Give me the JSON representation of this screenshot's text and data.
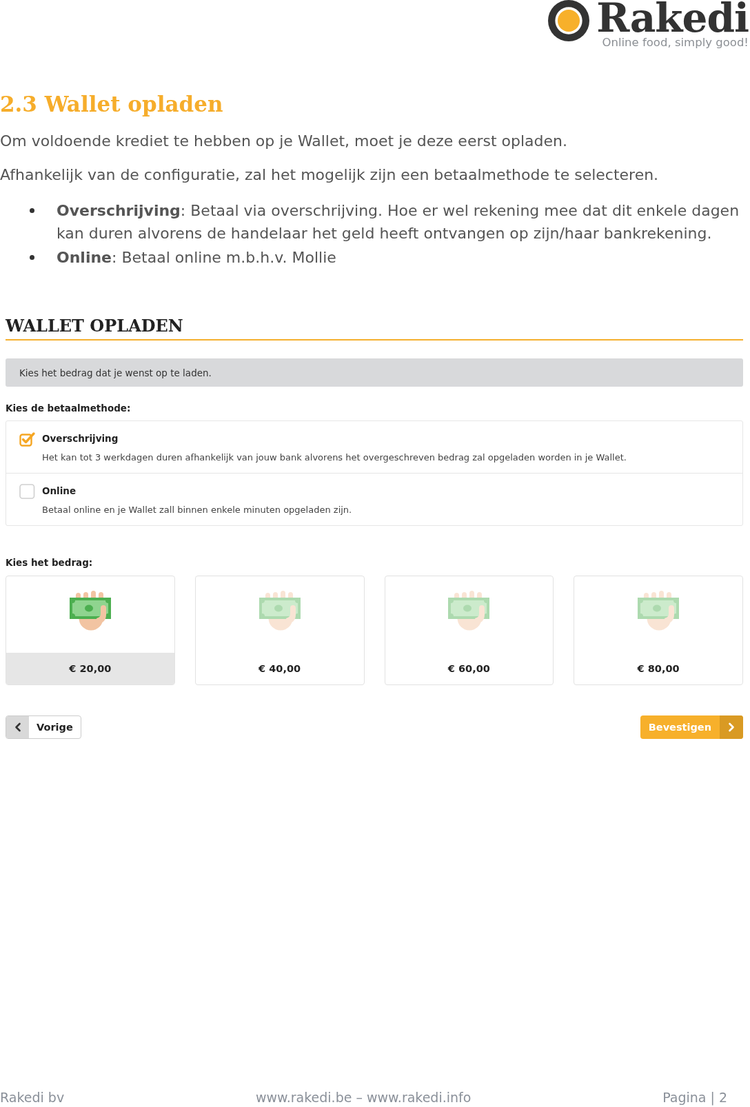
{
  "logo": {
    "name": "Rakedi",
    "tagline": "Online food, simply good!"
  },
  "heading": "2.3 Wallet opladen",
  "paragraphs": [
    "Om voldoende krediet te hebben op je Wallet, moet je deze eerst opladen.",
    "Afhankelijk van de configuratie, zal het mogelijk zijn een betaalmethode te selecteren."
  ],
  "bullets": [
    "**Overschrijving**: Betaal via overschrijving. Hoe er wel rekening mee dat dit enkele dagen kan duren alvorens de handelaar het geld heeft ontvangen op zijn/haar bankrekening.",
    "**Online**: Betaal online m.b.h.v. Mollie"
  ],
  "wallet": {
    "title": "WALLET OPLADEN",
    "info": "Kies het bedrag dat je wenst op te laden.",
    "method_label": "Kies de betaalmethode:",
    "methods": [
      {
        "label": "Overschrijving",
        "description": "Het kan tot 3 werkdagen duren afhankelijk van jouw bank alvorens het overgeschreven bedrag zal opgeladen worden in je Wallet.",
        "checked": true
      },
      {
        "label": "Online",
        "description": "Betaal online en je Wallet zall binnen enkele minuten opgeladen zijn.",
        "checked": false
      }
    ],
    "amount_label": "Kies het bedrag:",
    "amounts": [
      {
        "label": "€ 20,00",
        "selected": true
      },
      {
        "label": "€ 40,00",
        "selected": false
      },
      {
        "label": "€ 60,00",
        "selected": false
      },
      {
        "label": "€ 80,00",
        "selected": false
      }
    ],
    "buttons": [
      {
        "kind": "back",
        "label": "Vorige"
      },
      {
        "kind": "confirm",
        "label": "Bevestigen"
      }
    ]
  },
  "footer": {
    "left": "Rakedi bv",
    "center": "www.rakedi.be – www.rakedi.info",
    "right": "Pagina | 2"
  }
}
